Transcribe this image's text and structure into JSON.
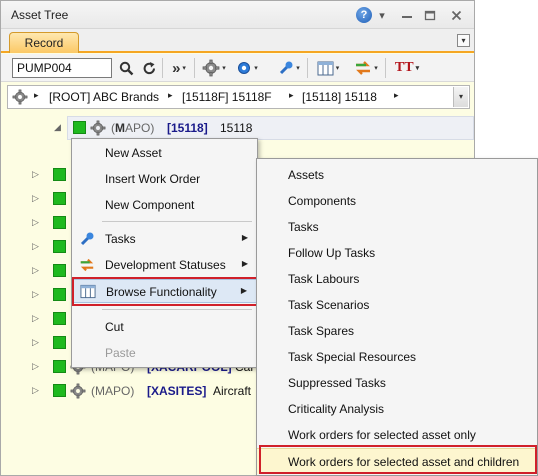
{
  "window": {
    "title": "Asset Tree",
    "help_icon": "?",
    "help_arrow": "▾",
    "minimize": "▭",
    "restore": "▣",
    "close": "✕"
  },
  "tabs": {
    "record": "Record",
    "menu": "▾"
  },
  "toolbar": {
    "search_value": "PUMP004",
    "text_format": "TT",
    "icons": [
      "search-icon",
      "refresh-icon",
      "next-icon",
      "gear-icon",
      "settings-icon",
      "tools-icon",
      "view-icon",
      "transfer-icon",
      "text-format-icon"
    ]
  },
  "breadcrumb": {
    "items": [
      "[ROOT] ABC Brands",
      "[15118F] 15118F",
      "[15118] 15118"
    ],
    "separator": "▸",
    "dropdown": "▾"
  },
  "tree": {
    "expander_open": "◢",
    "expander_closed": "▷",
    "root_row": {
      "type_prefix": "(",
      "type_m": "M",
      "type_rest": "APO)",
      "code": "[15118]",
      "name": "15118"
    },
    "rows": [
      {
        "type": "(MAPO)",
        "code": "[XACARPOOL]",
        "name": "Car"
      },
      {
        "type": "(MAPO)",
        "code": "[XASITES]",
        "name": "Aircraft"
      }
    ]
  },
  "context_menu": {
    "items": [
      {
        "label": "New Asset"
      },
      {
        "label": "Insert Work Order"
      },
      {
        "label": "New Component"
      },
      {
        "label": "Tasks",
        "has_submenu": true
      },
      {
        "label": "Development Statuses",
        "has_submenu": true
      },
      {
        "label": "Browse Functionality",
        "has_submenu": true,
        "selected": true
      },
      {
        "label": "Cut"
      },
      {
        "label": "Paste",
        "disabled": true
      }
    ],
    "submenu_arrow": "▶"
  },
  "sub_menu": {
    "items": [
      "Assets",
      "Components",
      "Tasks",
      "Follow Up Tasks",
      "Task Labours",
      "Task Scenarios",
      "Task Spares",
      "Task Special Resources",
      "Suppressed Tasks",
      "Criticality Analysis",
      "Work orders for selected asset only",
      "Work orders for selected asset and children"
    ]
  },
  "colors": {
    "tree_background": "#fdfde3",
    "status_green": "#1fb91f",
    "highlight_red": "#d0202a",
    "tab_orange": "#fbc865",
    "code_blue": "#1a1a8a"
  }
}
